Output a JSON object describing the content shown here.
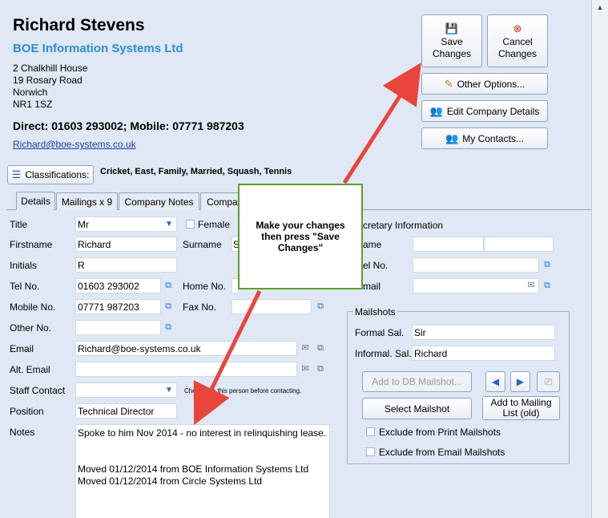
{
  "contact": {
    "name": "Richard Stevens",
    "company": "BOE Information Systems Ltd",
    "address": [
      "2 Chalkhill House",
      "19 Rosary Road",
      "Norwich",
      "NR1 1SZ"
    ],
    "phones": "Direct: 01603 293002; Mobile: 07771 987203",
    "email": "Richard@boe-systems.co.uk"
  },
  "actions": {
    "save_l1": "Save",
    "save_l2": "Changes",
    "cancel_l1": "Cancel",
    "cancel_l2": "Changes",
    "other_options": "Other Options...",
    "edit_company": "Edit Company Details",
    "my_contacts": "My Contacts..."
  },
  "classifications": {
    "button": "Classifications:",
    "tags": "Cricket, East, Family, Married, Squash, Tennis"
  },
  "tabs": [
    "Details",
    "Mailings x 9",
    "Company Notes",
    "Compa"
  ],
  "form": {
    "title_label": "Title",
    "title_value": "Mr",
    "female_label": "Female",
    "firstname_label": "Firstname",
    "firstname_value": "Richard",
    "surname_label": "Surname",
    "surname_value": "S",
    "initials_label": "Initials",
    "initials_value": "R",
    "tel_label": "Tel No.",
    "tel_value": "01603 293002",
    "home_label": "Home No.",
    "mobile_label": "Mobile No.",
    "mobile_value": "07771 987203",
    "fax_label": "Fax No.",
    "other_label": "Other No.",
    "email_label": "Email",
    "email_value": "Richard@boe-systems.co.uk",
    "alt_email_label": "Alt. Email",
    "staff_label": "Staff Contact",
    "staff_hint": "Check with this person before contacting.",
    "position_label": "Position",
    "position_value": "Technical Director",
    "notes_label": "Notes",
    "notes_value": "Spoke to him Nov 2014 - no interest in relinquishing lease.\n\n\nMoved 01/12/2014 from BOE Information Systems Ltd\nMoved 01/12/2014 from Circle Systems Ltd"
  },
  "secretary": {
    "header": "cretary Information",
    "name_label": "ame",
    "tel_label": "el No.",
    "email_label": "mail"
  },
  "mailshots": {
    "title": "Mailshots",
    "formal_label": "Formal Sal.",
    "formal_value": "Sir",
    "informal_label": "Informal. Sal.",
    "informal_value": "Richard",
    "add_db": "Add to DB Mailshot...",
    "select": "Select Mailshot",
    "add_list_l1": "Add to Mailing",
    "add_list_l2": "List (old)",
    "exclude_print": "Exclude from Print Mailshots",
    "exclude_email": "Exclude from Email Mailshots"
  },
  "callout": "Make your changes then press \"Save Changes\"",
  "colors": {
    "accent": "#2a8fd8",
    "arrow": "#e8453c",
    "callout_border": "#5aa02c"
  },
  "icons": {
    "save": "floppy-disk-icon",
    "cancel": "red-x-icon",
    "options": "pencil-icon",
    "company": "people-icon",
    "contacts": "contacts-icon",
    "classifications": "list-icon",
    "copy": "copy-icon",
    "mail": "envelope-icon"
  }
}
